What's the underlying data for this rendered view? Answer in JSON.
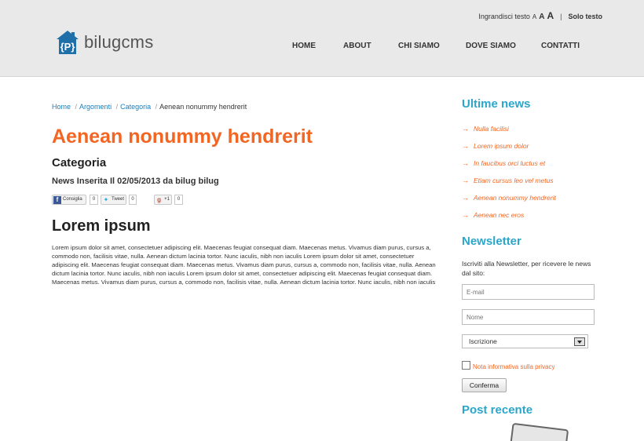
{
  "header": {
    "text_size_label": "Ingrandisci testo",
    "size_a1": "A",
    "size_a2": "A",
    "size_a3": "A",
    "separator": "|",
    "text_only": "Solo testo",
    "logo_text": "bilugcms",
    "logo_letter": "P"
  },
  "nav": {
    "home": "HOME",
    "about": "ABOUT",
    "chi_siamo": "CHI SIAMO",
    "dove_siamo": "DOVE SIAMO",
    "contatti": "CONTATTI"
  },
  "breadcrumb": {
    "items": [
      "Home",
      "Argomenti",
      "Categoria"
    ],
    "separator": "/",
    "current": "Aenean nonummy hendrerit"
  },
  "article": {
    "title": "Aenean nonummy hendrerit",
    "category": "Categoria",
    "meta": "News Inserita Il 02/05/2013 da bilug bilug",
    "subtitle": "Lorem ipsum",
    "body": "Lorem ipsum dolor sit amet, consectetuer adipiscing elit. Maecenas feugiat consequat diam. Maecenas metus. Vivamus diam purus, cursus a, commodo non, facilisis vitae, nulla. Aenean dictum lacinia tortor. Nunc iaculis, nibh non iaculis Lorem ipsum dolor sit amet, consectetuer adipiscing elit. Maecenas feugiat consequat diam. Maecenas metus. Vivamus diam purus, cursus a, commodo non, facilisis vitae, nulla. Aenean dictum lacinia tortor. Nunc iaculis, nibh non iaculis Lorem ipsum dolor sit amet, consectetuer adipiscing elit. Maecenas feugiat consequat diam. Maecenas metus. Vivamus diam purus, cursus a, commodo non, facilisis vitae, nulla. Aenean dictum lacinia tortor. Nunc iaculis, nibh non iaculis"
  },
  "social": {
    "facebook_label": "Consiglia",
    "facebook_icon": "f",
    "facebook_count": "0",
    "tweet_label": "Tweet",
    "tweet_count": "0",
    "gplus_label": "+1",
    "gplus_icon": "g",
    "gplus_count": "0"
  },
  "sidebar": {
    "news_title": "Ultime news",
    "news_bullet": "→",
    "news_items": [
      "Nulla facilisi",
      "Lorem ipsum dolor",
      "In faucibus orci luctus et",
      "Etiam cursus leo vel metus",
      "Aenean nonummy hendrerit",
      "Aenean nec eros"
    ],
    "newsletter_title": "Newsletter",
    "newsletter_text": "Iscriviti alla Newsletter, per ricevere le news dal sito:",
    "email_placeholder": "E-mail",
    "name_placeholder": "Nome",
    "select_value": "Iscrizione",
    "privacy_label": "Nota informativa sulla privacy",
    "confirm_label": "Conferma",
    "recent_title": "Post recente"
  },
  "colors": {
    "accent_orange": "#f26522",
    "accent_blue": "#2ba6cb",
    "link_blue": "#1a7ebf",
    "header_bg": "#e9e9e9"
  }
}
